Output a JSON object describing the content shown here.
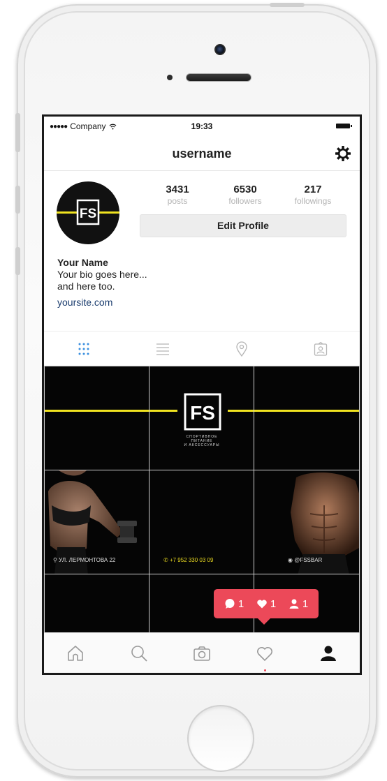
{
  "status_bar": {
    "signal": "●●●●●",
    "carrier": "Company",
    "time": "19:33"
  },
  "header": {
    "username": "username"
  },
  "profile": {
    "stats": [
      {
        "value": "3431",
        "label": "posts"
      },
      {
        "value": "6530",
        "label": "followers"
      },
      {
        "value": "217",
        "label": "followings"
      }
    ],
    "edit_label": "Edit Profile",
    "name": "Your Name",
    "bio_line1": "Your bio goes here...",
    "bio_line2": "and here too.",
    "website": "yoursite.com",
    "avatar_logo": "FS"
  },
  "tabs": [
    "grid-icon",
    "list-icon",
    "location-pin-icon",
    "tagged-person-icon"
  ],
  "grid": {
    "logo": "FS",
    "brand_lines": [
      "СПОРТИВНОЕ",
      "ПИТАНИЕ",
      "И АКСЕССУАРЫ"
    ],
    "address": "УЛ. ЛЕРМОНТОВА 22",
    "phone": "+7 952 330 03 09",
    "handle": "@FSSBAR"
  },
  "notification": {
    "comments": "1",
    "likes": "1",
    "follows": "1"
  },
  "tabbar": [
    "home-icon",
    "search-icon",
    "camera-icon",
    "heart-icon",
    "profile-icon"
  ],
  "colors": {
    "accent_red": "#ec4959",
    "brand_yellow": "#f0e320",
    "link_blue": "#1a3c6e",
    "active_tab_blue": "#3a8fe0"
  }
}
